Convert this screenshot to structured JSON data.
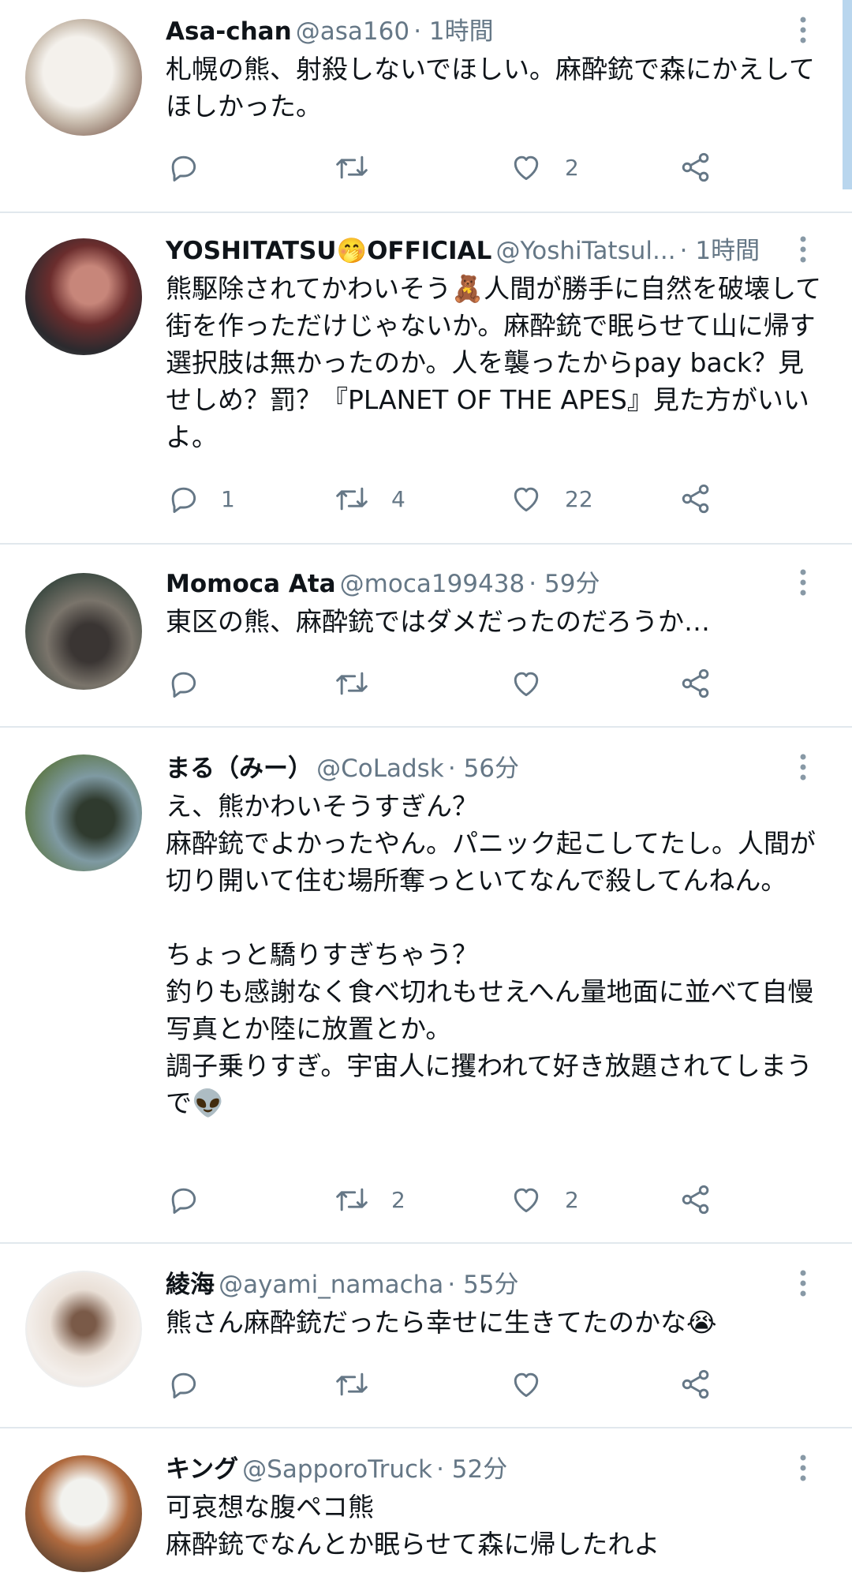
{
  "tweets": [
    {
      "name": "Asa-chan",
      "handle": "@asa160",
      "time": "· 1時間",
      "text": "札幌の熊、射殺しないでほしい。麻酔銃で森にかえしてほしかった。",
      "replies": "",
      "retweets": "",
      "likes": "2"
    },
    {
      "name": "YOSHITATSU🤭OFFICIAL",
      "handle": "@YoshiTatsul...",
      "time": "· 1時間",
      "text": "熊駆除されてかわいそう🧸人間が勝手に自然を破壊して街を作っただけじゃないか。麻酔銃で眠らせて山に帰す選択肢は無かったのか。人を襲ったからpay back？見せしめ？罰？『PLANET OF THE APES』見た方がいいよ。",
      "replies": "1",
      "retweets": "4",
      "likes": "22"
    },
    {
      "name": "Momoca Ata",
      "handle": "@moca199438",
      "time": "· 59分",
      "text": "東区の熊、麻酔銃ではダメだったのだろうか…",
      "replies": "",
      "retweets": "",
      "likes": ""
    },
    {
      "name": "まる（みー）",
      "handle": "@CoLadsk",
      "time": "· 56分",
      "text": "え、熊かわいそうすぎん？\n麻酔銃でよかったやん。パニック起こしてたし。人間が切り開いて住む場所奪っといてなんで殺してんねん。\n\nちょっと驕りすぎちゃう？\n釣りも感謝なく食べ切れもせえへん量地面に並べて自慢写真とか陸に放置とか。\n調子乗りすぎ。宇宙人に攫われて好き放題されてしまうで👽",
      "replies": "",
      "retweets": "2",
      "likes": "2"
    },
    {
      "name": "綾海",
      "handle": "@ayami_namacha",
      "time": "· 55分",
      "text": "熊さん麻酔銃だったら幸せに生きてたのかな😭",
      "replies": "",
      "retweets": "",
      "likes": ""
    },
    {
      "name": "キング",
      "handle": "@SapporoTruck",
      "time": "· 52分",
      "text": "可哀想な腹ペコ熊\n麻酔銃でなんとか眠らせて森に帰したれよ",
      "replies": "",
      "retweets": "",
      "likes": ""
    }
  ],
  "icons": {
    "reply": "reply-icon",
    "retweet": "retweet-icon",
    "like": "like-icon",
    "share": "share-icon",
    "more": "more-icon"
  },
  "colors": {
    "text": "#0f1419",
    "secondary": "#657786",
    "divider": "#e1e8ed",
    "scrollbar": "#b9d6ee"
  }
}
